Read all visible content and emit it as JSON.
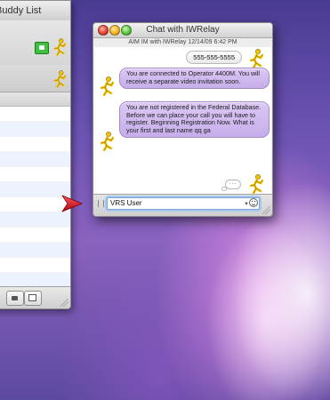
{
  "buddy_list": {
    "title": "Buddy List"
  },
  "chat_window": {
    "title": "Chat with IWRelay",
    "header": "AIM IM with IWRelay   12/14/09 6:42 PM",
    "messages": [
      {
        "from": "me",
        "text": "555-555-5555"
      },
      {
        "from": "IWRelay",
        "text": "You are connected to Operator 4400M. You will receive a separate video invitation soon."
      },
      {
        "from": "IWRelay",
        "text": "You are not registered in the Federal Database. Before we can place your call you will have to register. Beginning Registration Now. What is your first and last name qq ga"
      }
    ],
    "input_value": "VRS User"
  },
  "colors": {
    "incoming_bubble": "#c5aeea",
    "outgoing_bubble": "#f0f0f0",
    "aim_runner": "#f5c400",
    "pointer_arrow": "#e0141c",
    "input_focus": "#a9c8f0"
  },
  "icons": {
    "buddy_video": "video-camera-icon",
    "aim_runner": "aim-running-man-icon",
    "smiley": "smiley-icon",
    "pointer": "red-arrow-icon"
  }
}
